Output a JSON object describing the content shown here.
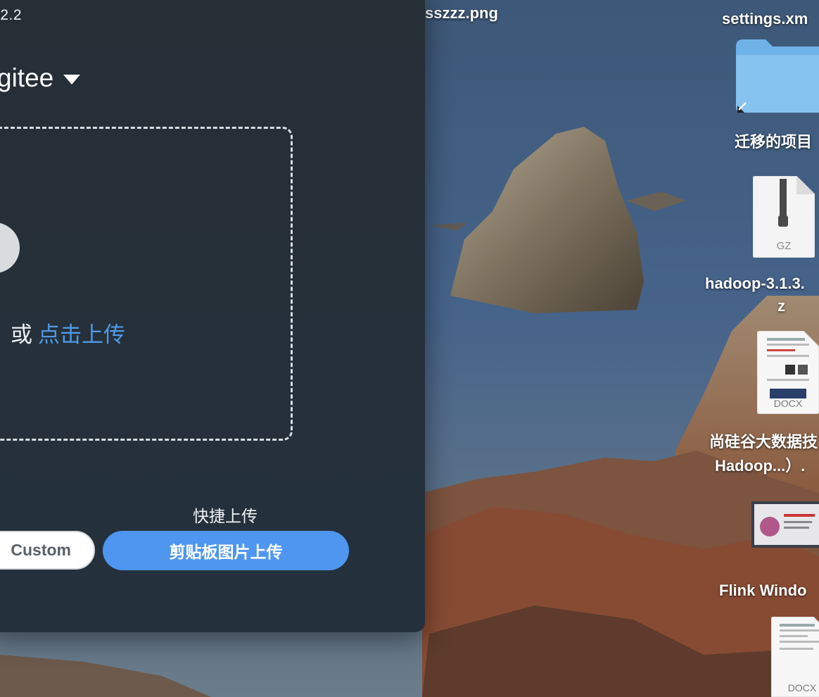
{
  "window": {
    "version": ".2.2",
    "picbed": {
      "name": "gitee"
    },
    "drop_zone": {
      "or_text": "或",
      "click_upload": "点击上传"
    },
    "quick_upload": {
      "label": "快捷上传",
      "custom_button": "Custom",
      "clipboard_button": "剪贴板图片上传"
    }
  },
  "desktop": {
    "top_file": "sszzz.png",
    "settings_file": "settings.xm",
    "folder": {
      "label": "迁移的项目"
    },
    "gz_file": {
      "type": "GZ",
      "label_line1": "hadoop-3.1.3.",
      "label_line2": "z"
    },
    "docx_file_1": {
      "type": "DOCX",
      "label_line1": "尚硅谷大数据技",
      "label_line2": "Hadoop...）."
    },
    "flink_file": {
      "label": "Flink Windo"
    },
    "docx_file_2": {
      "type": "DOCX"
    }
  },
  "colors": {
    "accent": "#4e96f0",
    "link": "#4f9ae6",
    "window_bg": "#25303a"
  }
}
